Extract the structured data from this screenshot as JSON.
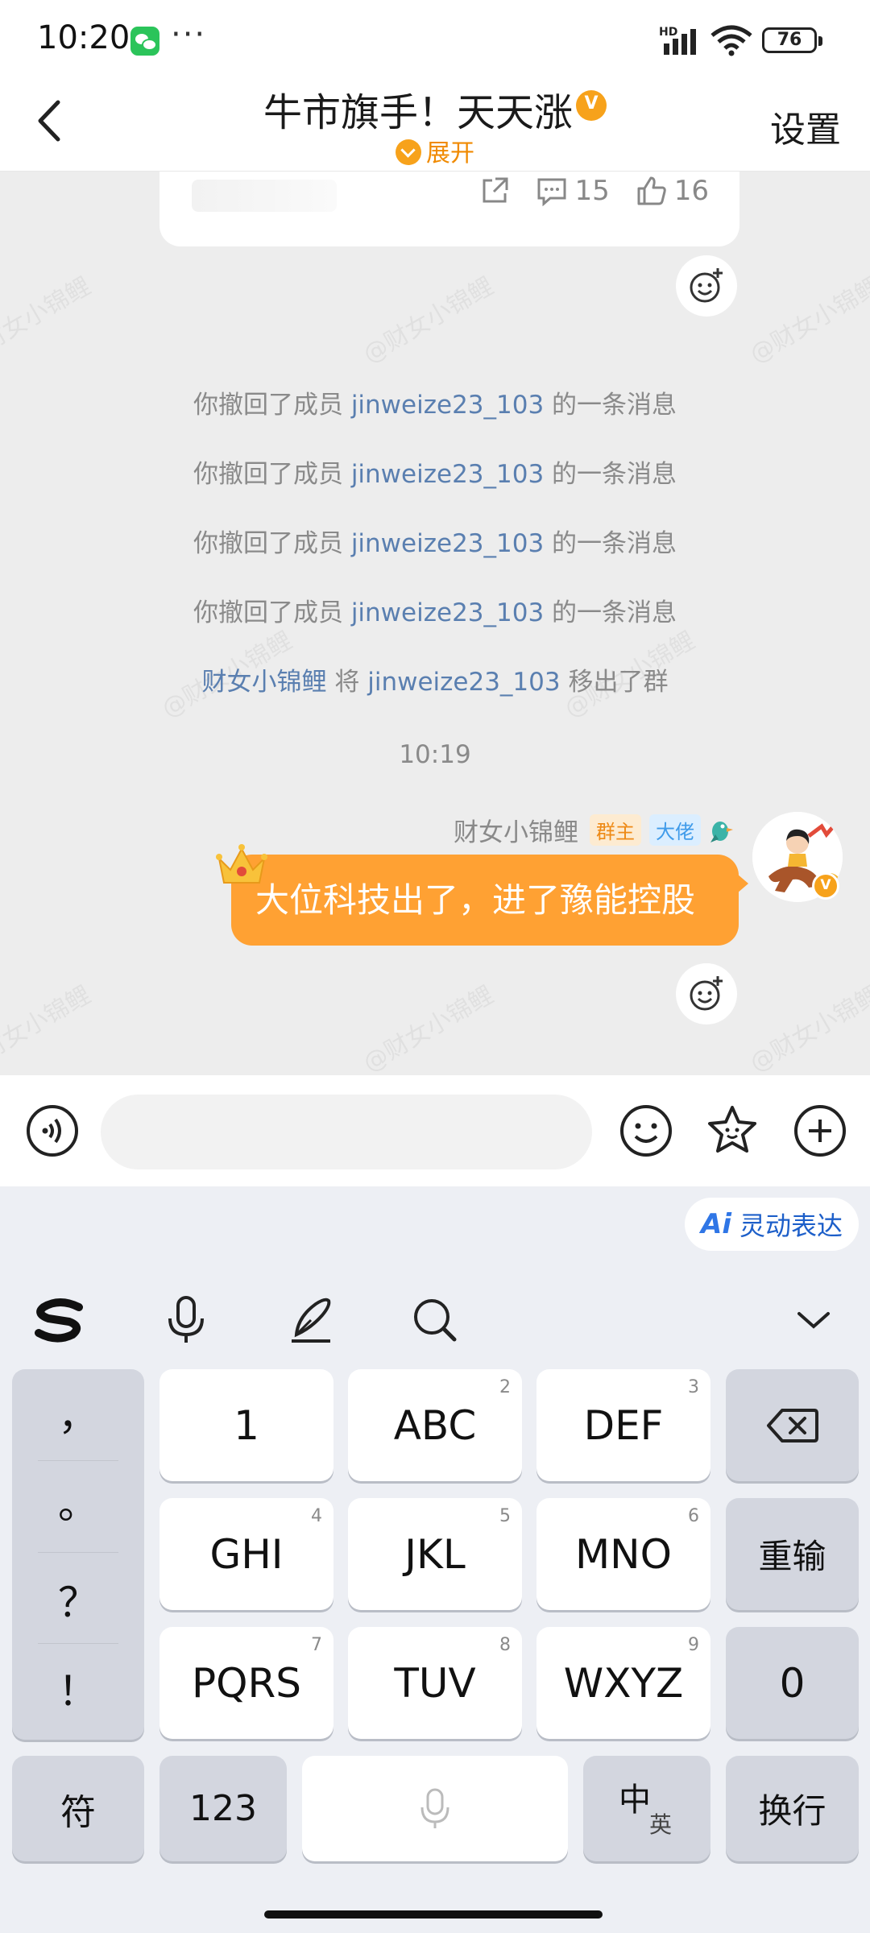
{
  "status_bar": {
    "time": "10:20",
    "more": "···",
    "network": "HD",
    "battery": "76"
  },
  "header": {
    "title": "牛市旗手！天天涨",
    "expand": "展开",
    "settings": "设置"
  },
  "shared_card": {
    "comments": "15",
    "likes": "16"
  },
  "watermark": "@财女小锦鲤",
  "system_messages": [
    {
      "prefix": "你撤回了成员 ",
      "user": "jinweize23_103",
      "suffix": " 的一条消息"
    },
    {
      "prefix": "你撤回了成员 ",
      "user": "jinweize23_103",
      "suffix": " 的一条消息"
    },
    {
      "prefix": "你撤回了成员 ",
      "user": "jinweize23_103",
      "suffix": " 的一条消息"
    },
    {
      "prefix": "你撤回了成员 ",
      "user": "jinweize23_103",
      "suffix": " 的一条消息"
    }
  ],
  "remove_message": {
    "actor": "财女小锦鲤",
    "middle": " 将 ",
    "target": "jinweize23_103",
    "suffix": " 移出了群"
  },
  "timestamp": "10:19",
  "message": {
    "sender": "财女小锦鲤",
    "tag_owner": "群主",
    "tag_boss": "大佬",
    "text": "大位科技出了，进了豫能控股"
  },
  "input": {
    "placeholder": ""
  },
  "keyboard": {
    "smart_chip": "灵动表达",
    "smart_chip_ai": "Ai",
    "punctuation": [
      "，",
      "。",
      "？",
      "！"
    ],
    "rows": [
      [
        {
          "label": "1",
          "num": ""
        },
        {
          "label": "ABC",
          "num": "2"
        },
        {
          "label": "DEF",
          "num": "3"
        }
      ],
      [
        {
          "label": "GHI",
          "num": "4"
        },
        {
          "label": "JKL",
          "num": "5"
        },
        {
          "label": "MNO",
          "num": "6"
        }
      ],
      [
        {
          "label": "PQRS",
          "num": "7"
        },
        {
          "label": "TUV",
          "num": "8"
        },
        {
          "label": "WXYZ",
          "num": "9"
        }
      ]
    ],
    "retype": "重输",
    "zero": "0",
    "symbols": "符",
    "numbers": "123",
    "lang_main": "中",
    "lang_sub": "英",
    "newline": "换行"
  },
  "colors": {
    "accent": "#ffa133",
    "link": "#5a7fb0",
    "chat_bg": "#ededed",
    "keyboard_bg": "#edeff4"
  }
}
